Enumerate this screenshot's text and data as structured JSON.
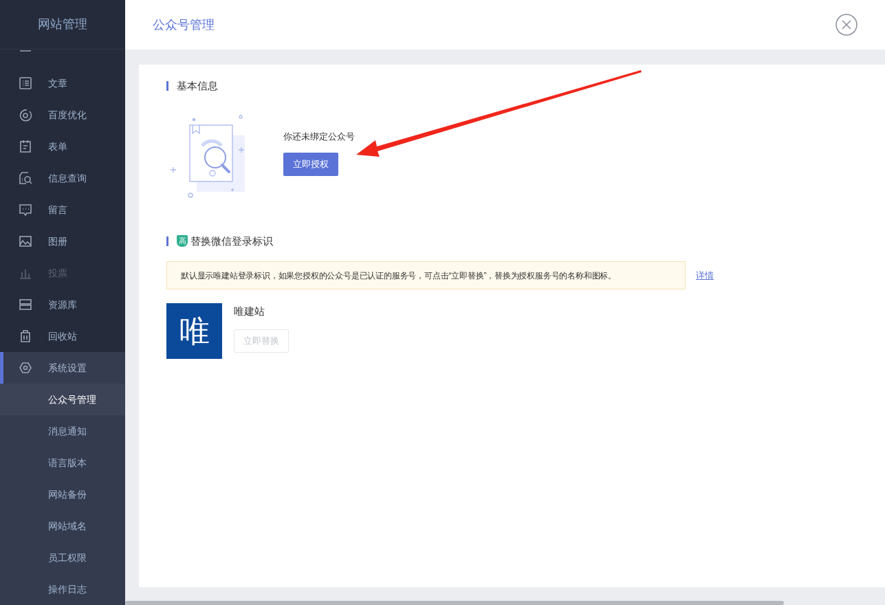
{
  "sidebar": {
    "title": "网站管理",
    "items": [
      {
        "label": "文章",
        "disabled": false,
        "selected": false
      },
      {
        "label": "百度优化",
        "disabled": false,
        "selected": false
      },
      {
        "label": "表单",
        "disabled": false,
        "selected": false
      },
      {
        "label": "信息查询",
        "disabled": false,
        "selected": false
      },
      {
        "label": "留言",
        "disabled": false,
        "selected": false
      },
      {
        "label": "图册",
        "disabled": false,
        "selected": false
      },
      {
        "label": "投票",
        "disabled": true,
        "selected": false
      },
      {
        "label": "资源库",
        "disabled": false,
        "selected": false
      },
      {
        "label": "回收站",
        "disabled": false,
        "selected": false
      },
      {
        "label": "系统设置",
        "disabled": false,
        "selected": true,
        "expanded": true,
        "children": [
          {
            "label": "公众号管理",
            "selected": true
          },
          {
            "label": "消息通知",
            "selected": false
          },
          {
            "label": "语言版本",
            "selected": false
          },
          {
            "label": "网站备份",
            "selected": false
          },
          {
            "label": "网站域名",
            "selected": false
          },
          {
            "label": "员工权限",
            "selected": false
          },
          {
            "label": "操作日志",
            "selected": false
          }
        ]
      }
    ]
  },
  "header": {
    "title": "公众号管理"
  },
  "basic_info": {
    "heading": "基本信息",
    "message": "你还未绑定公众号",
    "button": "立即授权"
  },
  "login_mark": {
    "heading": "替换微信登录标识",
    "badge": "高",
    "notice": "默认显示唯建站登录标识，如果您授权的公众号是已认证的服务号，可点击“立即替换”，替换为授权服务号的名称和图标。",
    "details_link": "详情",
    "logo_char": "唯",
    "name": "唯建站",
    "button": "立即替换",
    "button_disabled": true
  }
}
